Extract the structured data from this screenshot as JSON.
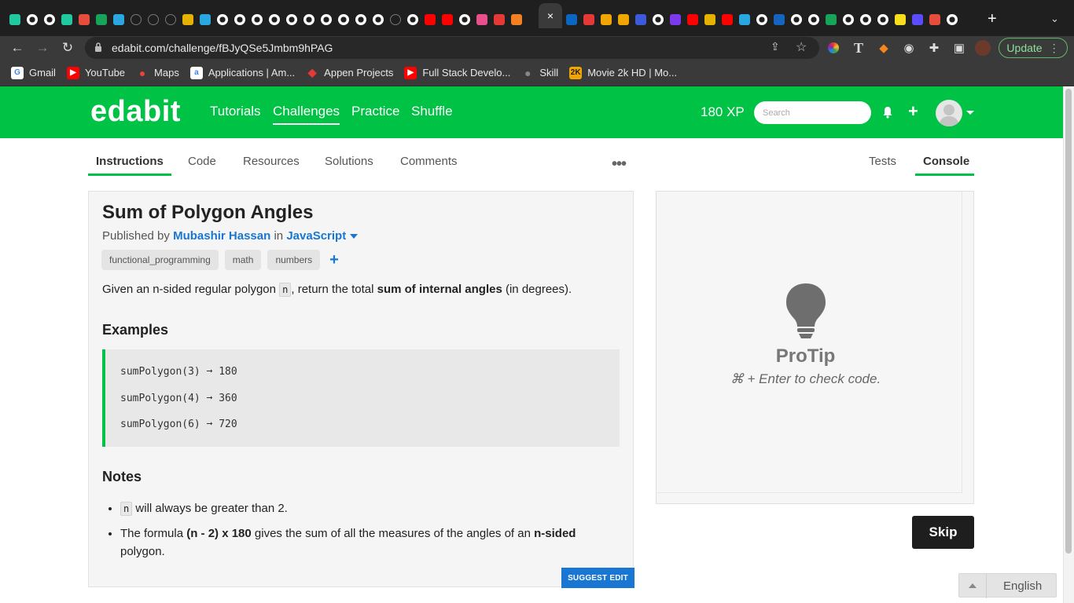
{
  "browser": {
    "tab_favicon_colors": [
      "#20c9a0",
      "#ffffff",
      "#ffffff",
      "#20c9a0",
      "#e84c3d",
      "#18a35a",
      "#2aa7e0",
      "#333333",
      "#333333",
      "#333333",
      "#e6b200",
      "#2aa7e0",
      "#ffffff",
      "#ffffff",
      "#ffffff",
      "#ffffff",
      "#ffffff",
      "#ffffff",
      "#ffffff",
      "#ffffff",
      "#ffffff",
      "#ffffff",
      "#333333",
      "#ffffff",
      "#ff0000",
      "#ff0000",
      "#ffffff",
      "#e94f8a",
      "#e53935",
      "#f48024"
    ],
    "tab_favicon_colors_right": [
      "#0a66c2",
      "#e53935",
      "#f0a500",
      "#f0a500",
      "#3b5bdb",
      "#ffffff",
      "#7c3aed",
      "#ff0000",
      "#e6b200",
      "#ff0000",
      "#2aa7e0",
      "#ffffff",
      "#1565c0",
      "#ffffff",
      "#ffffff",
      "#18a35a",
      "#ffffff",
      "#ffffff",
      "#ffffff",
      "#f7df1e",
      "#5b4cff",
      "#e84c3d",
      "#ffffff"
    ],
    "active_tab_close": "×",
    "new_tab": "+",
    "tab_menu": "⌄",
    "url": "edabit.com/challenge/fBJyQSe5Jmbm9hPAG",
    "update_label": "Update",
    "bookmarks": [
      {
        "label": "Gmail",
        "color": "#ffffff",
        "glyph": "G"
      },
      {
        "label": "YouTube",
        "color": "#ff0000",
        "glyph": "▶"
      },
      {
        "label": "Maps",
        "color": "#34a853",
        "glyph": "●"
      },
      {
        "label": "Applications | Am...",
        "color": "#ffffff",
        "glyph": "a"
      },
      {
        "label": "Appen Projects",
        "color": "#e53935",
        "glyph": "◆"
      },
      {
        "label": "Full Stack Develo...",
        "color": "#ff0000",
        "glyph": "▶"
      },
      {
        "label": "Skill",
        "color": "#777777",
        "glyph": "●"
      },
      {
        "label": "Movie 2k HD | Mo...",
        "color": "#f0a500",
        "glyph": "2K"
      }
    ]
  },
  "header": {
    "logo": "edabit",
    "nav": [
      {
        "label": "Tutorials",
        "active": false
      },
      {
        "label": "Challenges",
        "active": true
      },
      {
        "label": "Practice",
        "active": false
      },
      {
        "label": "Shuffle",
        "active": false
      }
    ],
    "xp": "180 XP",
    "search_placeholder": "Search",
    "brand_color": "#00c244"
  },
  "subnav": {
    "left_tabs": [
      "Instructions",
      "Code",
      "Resources",
      "Solutions",
      "Comments"
    ],
    "right_tabs": [
      "Tests",
      "Console"
    ],
    "more": "•••"
  },
  "challenge": {
    "title": "Sum of Polygon Angles",
    "published_by_prefix": "Published by",
    "author": "Mubashir Hassan",
    "in_word": "in",
    "language": "JavaScript",
    "tags": [
      "functional_programming",
      "math",
      "numbers"
    ],
    "tag_add": "+",
    "desc_1": "Given an n-sided regular polygon ",
    "desc_code": "n",
    "desc_2": ", return the total ",
    "desc_bold": "sum of internal angles",
    "desc_3": " (in degrees).",
    "examples_heading": "Examples",
    "examples": [
      {
        "call": "sumPolygon(3)",
        "arrow": "➞",
        "result": "180"
      },
      {
        "call": "sumPolygon(4)",
        "arrow": "➞",
        "result": "360"
      },
      {
        "call": "sumPolygon(6)",
        "arrow": "➞",
        "result": "720"
      }
    ],
    "notes_heading": "Notes",
    "note1_code": "n",
    "note1_text": " will always be greater than 2.",
    "note2_a": "The formula ",
    "note2_b": "(n - 2) x 180",
    "note2_c": " gives the sum of all the measures of the angles of an ",
    "note2_d": "n-sided",
    "note2_e": " polygon.",
    "suggest_edit": "SUGGEST EDIT"
  },
  "console": {
    "protip_title": "ProTip",
    "protip_text": "⌘ + Enter to check code."
  },
  "skip_label": "Skip",
  "language_selector": "English"
}
